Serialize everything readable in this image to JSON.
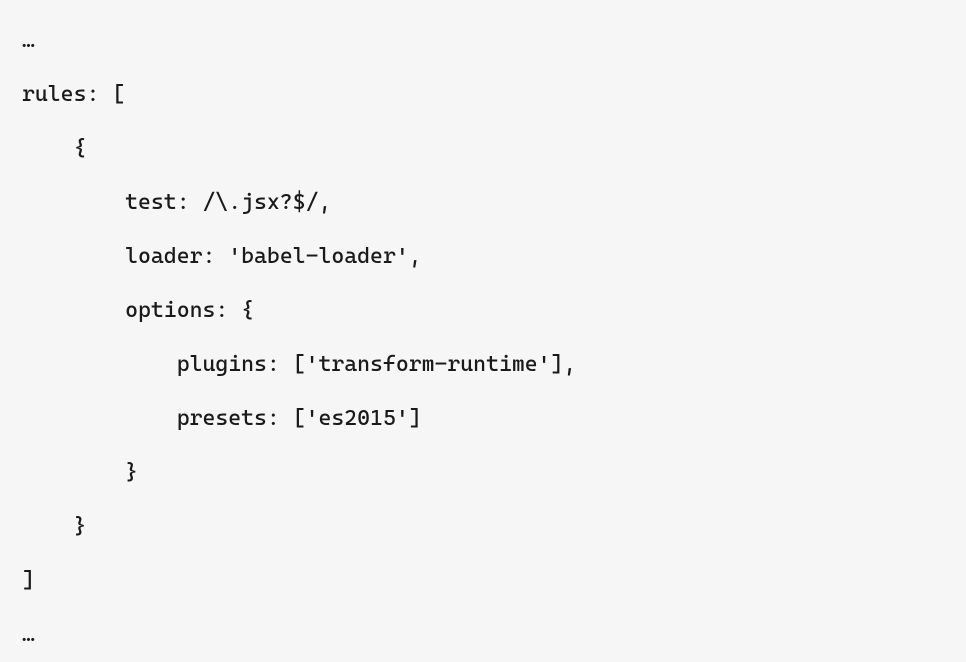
{
  "code": {
    "lines": [
      "…",
      "rules: [",
      "    {",
      "        test: /\\.jsx?$/,",
      "        loader: 'babel-loader',",
      "        options: {",
      "            plugins: ['transform-runtime'],",
      "            presets: ['es2015']",
      "        }",
      "    }",
      "]",
      "…"
    ]
  }
}
